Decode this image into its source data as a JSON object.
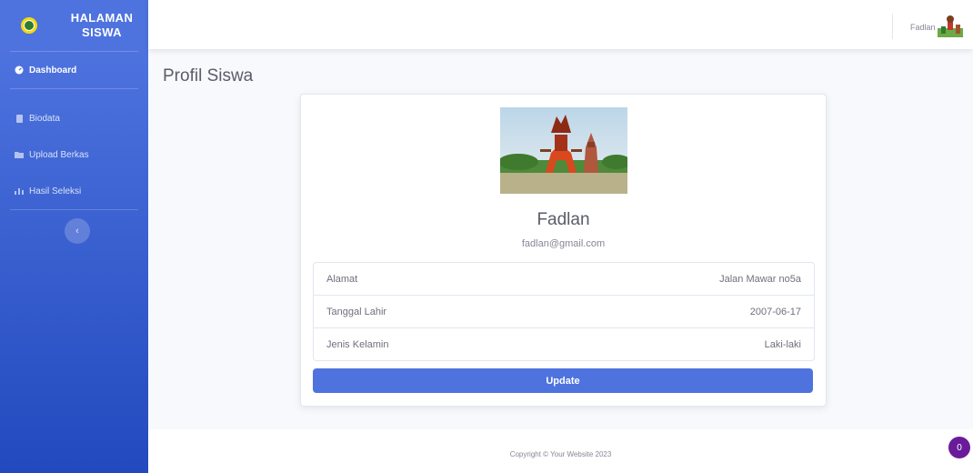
{
  "sidebar": {
    "brand": {
      "line1": "HALAMAN",
      "line2": "SISWA",
      "logo_icon": "school-logo-icon"
    },
    "items": [
      {
        "label": "Dashboard",
        "icon": "tachometer-icon",
        "active": true
      },
      {
        "label": "Biodata",
        "icon": "file-icon",
        "active": false
      },
      {
        "label": "Upload Berkas",
        "icon": "folder-icon",
        "active": false
      },
      {
        "label": "Hasil Seleksi",
        "icon": "chart-icon",
        "active": false
      }
    ],
    "toggle_glyph": "‹"
  },
  "topbar": {
    "user_name": "Fadlan",
    "avatar_icon": "user-avatar"
  },
  "main": {
    "page_title": "Profil Siswa",
    "profile": {
      "name": "Fadlan",
      "email": "fadlan@gmail.com",
      "fields": [
        {
          "label": "Alamat",
          "value": "Jalan Mawar no5a"
        },
        {
          "label": "Tanggal Lahir",
          "value": "2007-06-17"
        },
        {
          "label": "Jenis Kelamin",
          "value": "Laki-laki"
        }
      ],
      "update_label": "Update"
    }
  },
  "footer": {
    "copyright": "Copyright © Your Website 2023"
  },
  "notification_badge": "0",
  "colors": {
    "primary": "#4e73df",
    "sidebar_dark": "#224abe",
    "badge": "#6a1b9a"
  }
}
